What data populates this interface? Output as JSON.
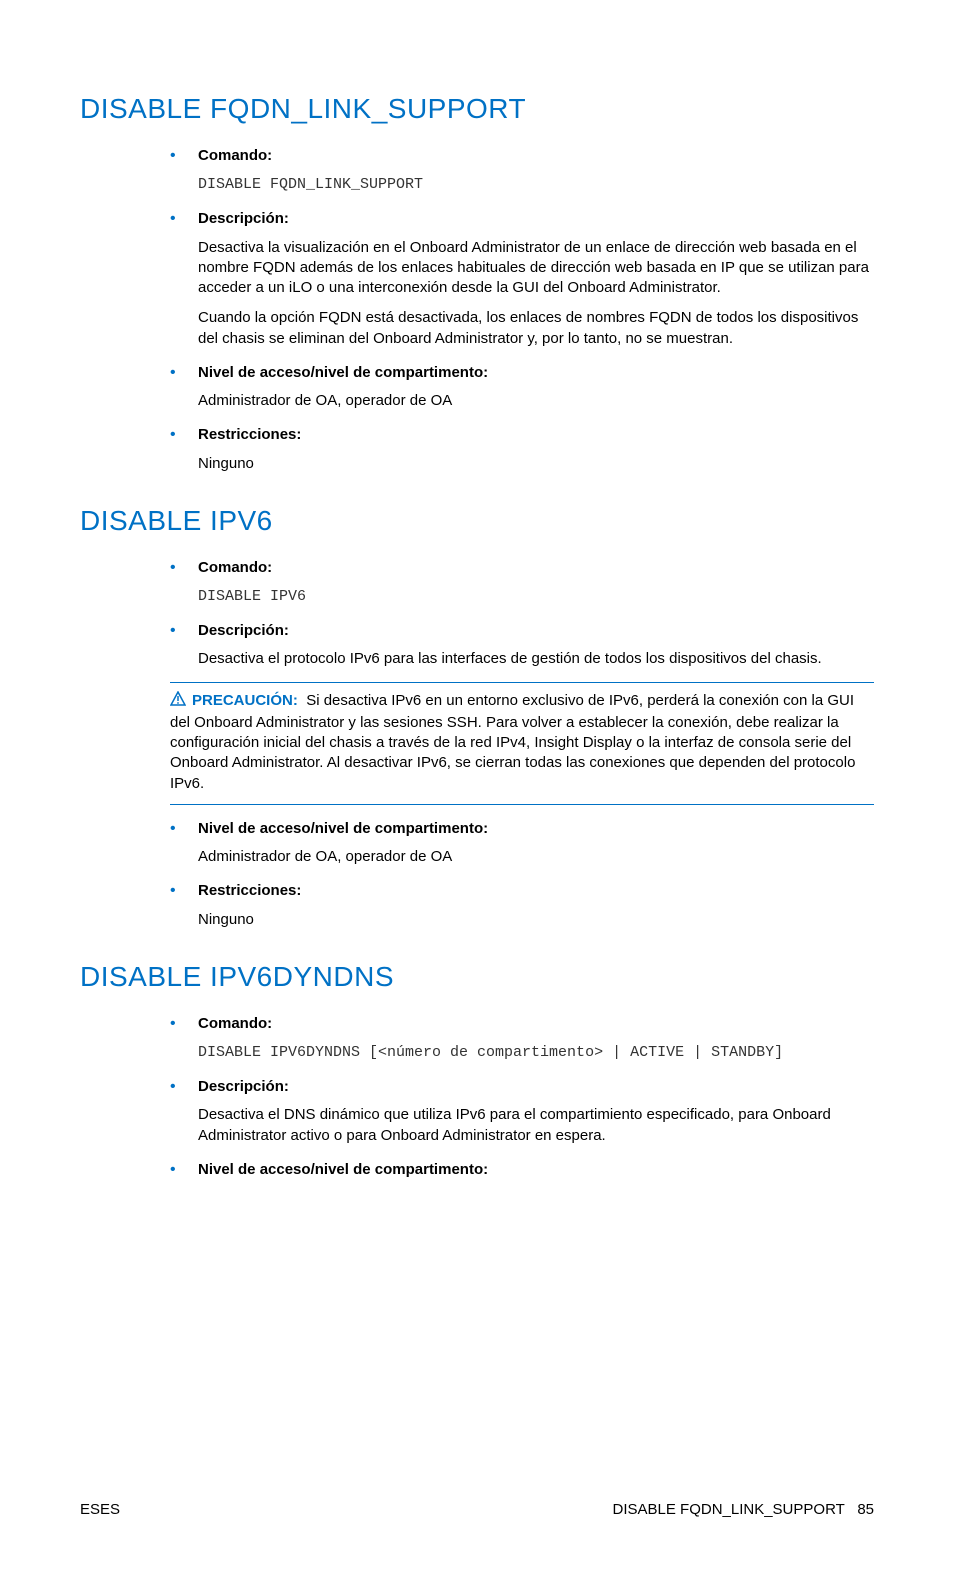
{
  "sections": [
    {
      "heading": "DISABLE FQDN_LINK_SUPPORT",
      "items": [
        {
          "label": "Comando:",
          "code": "DISABLE FQDN_LINK_SUPPORT"
        },
        {
          "label": "Descripción:",
          "paras": [
            "Desactiva la visualización en el Onboard Administrator de un enlace de dirección web basada en el nombre FQDN además de los enlaces habituales de dirección web basada en IP que se utilizan para acceder a un iLO o una interconexión desde la GUI del Onboard Administrator.",
            "Cuando la opción FQDN está desactivada, los enlaces de nombres FQDN de todos los dispositivos del chasis se eliminan del Onboard Administrator y, por lo tanto, no se muestran."
          ]
        },
        {
          "label": "Nivel de acceso/nivel de compartimento:",
          "text": "Administrador de OA, operador de OA"
        },
        {
          "label": "Restricciones:",
          "text": "Ninguno"
        }
      ]
    },
    {
      "heading": "DISABLE IPV6",
      "items": [
        {
          "label": "Comando:",
          "code": "DISABLE IPV6"
        },
        {
          "label": "Descripción:",
          "paras": [
            "Desactiva el protocolo IPv6 para las interfaces de gestión de todos los dispositivos del chasis."
          ],
          "caution": {
            "label": "PRECAUCIÓN:",
            "text": "Si desactiva IPv6 en un entorno exclusivo de IPv6, perderá la conexión con la GUI del Onboard Administrator y las sesiones SSH. Para volver a establecer la conexión, debe realizar la configuración inicial del chasis a través de la red IPv4, Insight Display o la interfaz de consola serie del Onboard Administrator. Al desactivar IPv6, se cierran todas las conexiones que dependen del protocolo IPv6."
          }
        },
        {
          "label": "Nivel de acceso/nivel de compartimento:",
          "text": "Administrador de OA, operador de OA"
        },
        {
          "label": "Restricciones:",
          "text": "Ninguno"
        }
      ]
    },
    {
      "heading": "DISABLE IPV6DYNDNS",
      "items": [
        {
          "label": "Comando:",
          "code": "DISABLE IPV6DYNDNS [<número de compartimento> | ACTIVE | STANDBY]"
        },
        {
          "label": "Descripción:",
          "paras": [
            "Desactiva el DNS dinámico que utiliza IPv6 para el compartimiento especificado, para Onboard Administrator activo o para Onboard Administrator en espera."
          ]
        },
        {
          "label": "Nivel de acceso/nivel de compartimento:"
        }
      ]
    }
  ],
  "footer": {
    "left": "ESES",
    "right_text": "DISABLE FQDN_LINK_SUPPORT",
    "page": "85"
  }
}
